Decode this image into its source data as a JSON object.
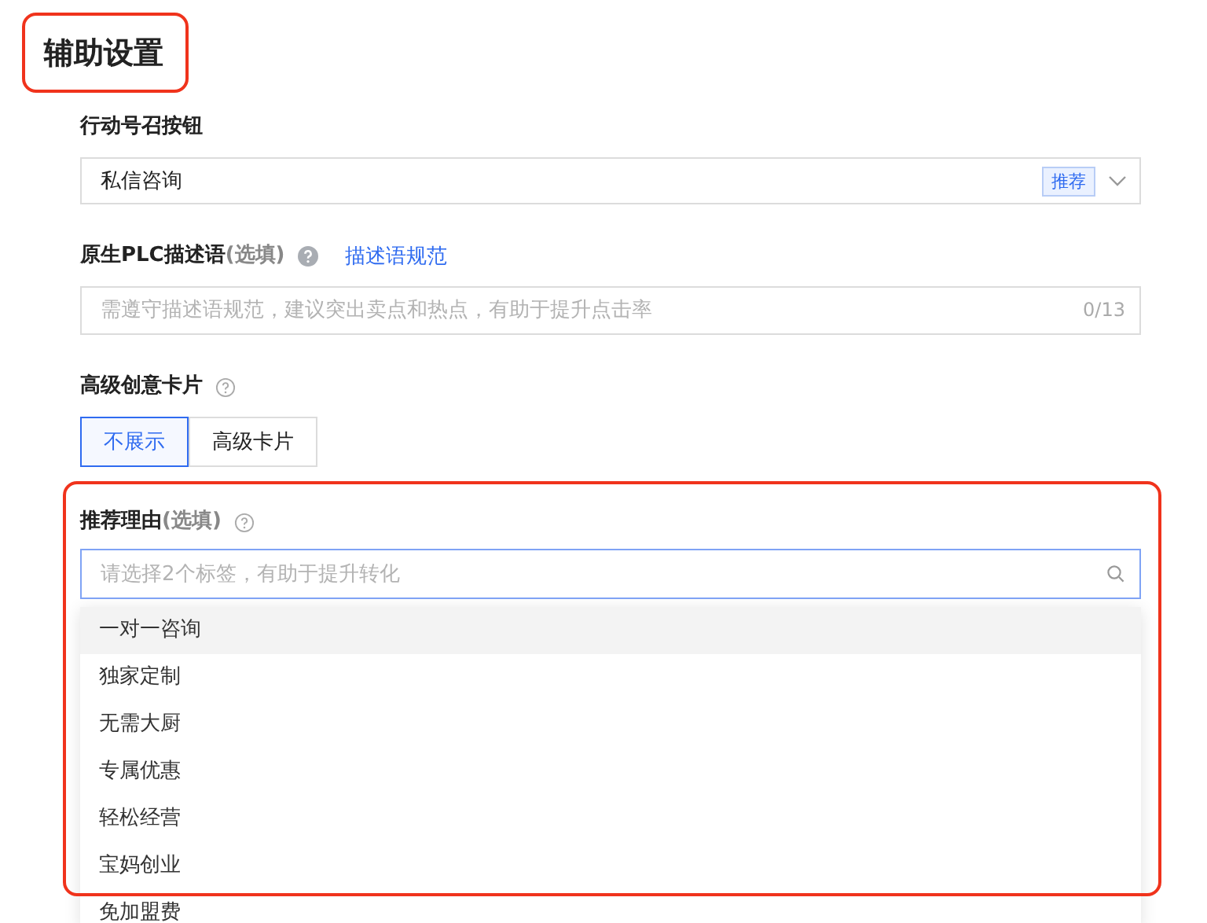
{
  "title": {
    "text": "辅助设置",
    "highlighted": true
  },
  "cta": {
    "label": "行动号召按钮",
    "value": "私信咨询",
    "tag": "推荐"
  },
  "description": {
    "label": "原生PLC描述语",
    "optional": "(选填)",
    "link": "描述语规范",
    "placeholder": "需遵守描述语规范，建议突出卖点和热点，有助于提升点击率",
    "counter": "0/13"
  },
  "card": {
    "label": "高级创意卡片",
    "options": [
      {
        "label": "不展示",
        "selected": true
      },
      {
        "label": "高级卡片",
        "selected": false
      }
    ]
  },
  "reason": {
    "label": "推荐理由",
    "optional": "(选填)",
    "highlighted": true,
    "placeholder": "请选择2个标签，有助于提升转化",
    "options": [
      {
        "label": "一对一咨询",
        "hovered": true
      },
      {
        "label": "独家定制",
        "hovered": false
      },
      {
        "label": "无需大厨",
        "hovered": false
      },
      {
        "label": "专属优惠",
        "hovered": false
      },
      {
        "label": "轻松经营",
        "hovered": false
      },
      {
        "label": "宝妈创业",
        "hovered": false
      },
      {
        "label": "免加盟费",
        "hovered": false
      }
    ]
  }
}
